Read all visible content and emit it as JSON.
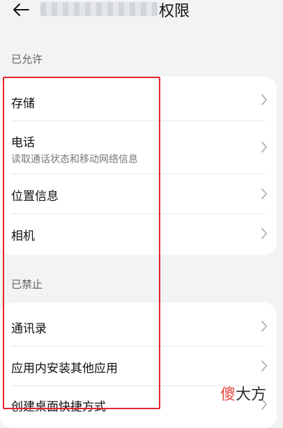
{
  "header": {
    "back_icon": "arrow-left-icon",
    "title": "权限"
  },
  "sections": [
    {
      "label": "已允许",
      "items": [
        {
          "title": "存储",
          "subtitle": ""
        },
        {
          "title": "电话",
          "subtitle": "读取通话状态和移动网络信息"
        },
        {
          "title": "位置信息",
          "subtitle": ""
        },
        {
          "title": "相机",
          "subtitle": ""
        }
      ]
    },
    {
      "label": "已禁止",
      "items": [
        {
          "title": "通讯录",
          "subtitle": ""
        },
        {
          "title": "应用内安装其他应用",
          "subtitle": ""
        },
        {
          "title": "创建桌面快捷方式",
          "subtitle": ""
        }
      ]
    }
  ],
  "watermark": {
    "part1": "傻",
    "part2": "大方",
    "color_accent": "#e23a2f"
  },
  "colors": {
    "background": "#f1f3f5",
    "card": "#ffffff",
    "annotation_box": "#e5252b"
  }
}
